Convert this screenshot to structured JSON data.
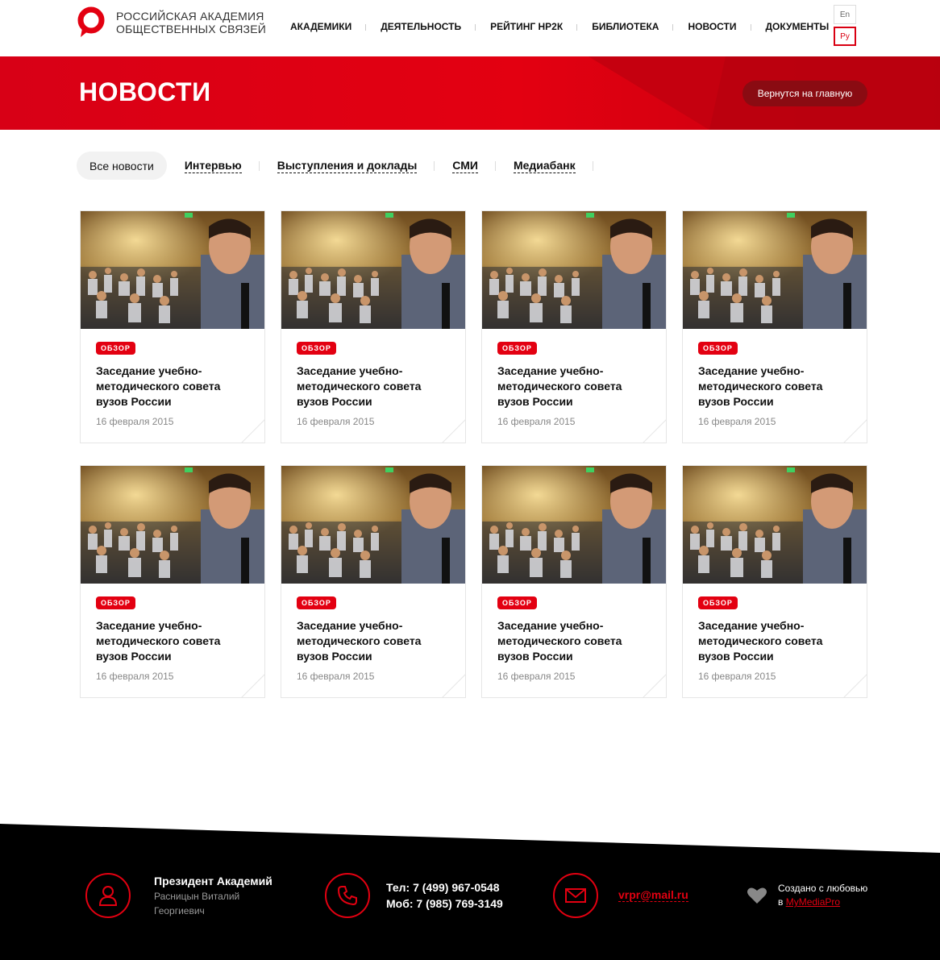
{
  "header": {
    "logo_line1": "Российская академия",
    "logo_line2": "общественных связей",
    "nav": [
      "Академики",
      "Деятельность",
      "Рейтинг НР2К",
      "Библиотека",
      "Новости",
      "Документы"
    ],
    "lang_en": "En",
    "lang_ru": "Ру"
  },
  "banner": {
    "title": "НОВОСТИ",
    "back_label": "Вернутся на главную"
  },
  "filters": {
    "all": "Все новости",
    "items": [
      "Интервью",
      "Выступления и доклады",
      "СМИ",
      "Медиабанк"
    ]
  },
  "cards": [
    {
      "tag": "ОБЗОР",
      "title": "Заседание учебно-методического совета вузов России",
      "date": "16 февраля 2015"
    },
    {
      "tag": "ОБЗОР",
      "title": "Заседание учебно-методического совета вузов России",
      "date": "16 февраля 2015"
    },
    {
      "tag": "ОБЗОР",
      "title": "Заседание учебно-методического совета вузов России",
      "date": "16 февраля 2015"
    },
    {
      "tag": "ОБЗОР",
      "title": "Заседание учебно-методического совета вузов России",
      "date": "16 февраля 2015"
    },
    {
      "tag": "ОБЗОР",
      "title": "Заседание учебно-методического совета вузов России",
      "date": "16 февраля 2015"
    },
    {
      "tag": "ОБЗОР",
      "title": "Заседание учебно-методического совета вузов России",
      "date": "16 февраля 2015"
    },
    {
      "tag": "ОБЗОР",
      "title": "Заседание учебно-методического совета вузов России",
      "date": "16 февраля 2015"
    },
    {
      "tag": "ОБЗОР",
      "title": "Заседание учебно-методического совета вузов России",
      "date": "16 февраля 2015"
    }
  ],
  "footer": {
    "president_title": "Президент Академий",
    "president_name_1": "Расницын Виталий",
    "president_name_2": "Георгиевич",
    "phone": "Тел: 7 (499) 967-0548",
    "mobile": "Моб: 7 (985) 769-3149",
    "email": "vrpr@mail.ru",
    "credit_line1": "Создано с любовью",
    "credit_prefix": "в",
    "credit_link": "MyMediaPro"
  },
  "colors": {
    "accent": "#e30011",
    "dark_red": "#8a0b12",
    "footer_bg": "#000000"
  },
  "icons": [
    "logo-mark-icon",
    "user-icon",
    "phone-icon",
    "mail-icon",
    "heart-icon"
  ]
}
